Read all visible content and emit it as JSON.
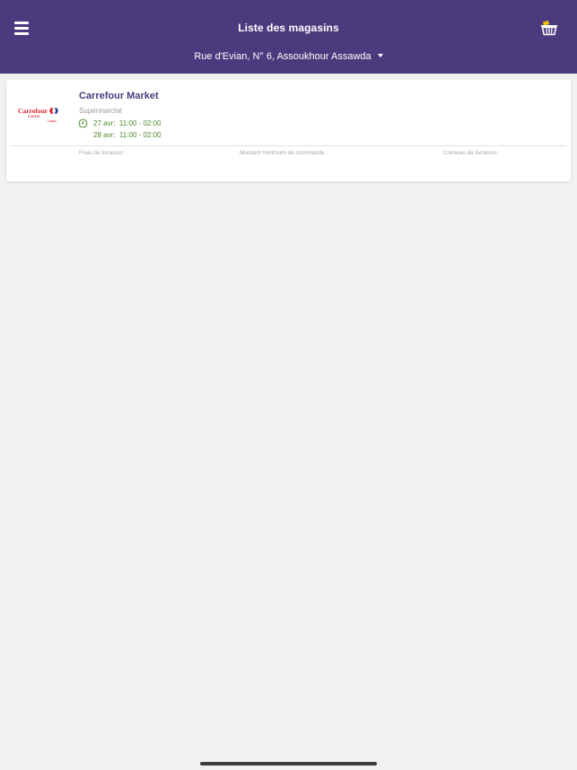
{
  "header": {
    "title": "Liste des magasins",
    "address": "Rue d'Evian, N° 6, Assoukhour Assawda",
    "menu_icon": "hamburger-menu-icon",
    "cart_icon": "shopping-basket-icon",
    "background": "#4b3b7e"
  },
  "stores": [
    {
      "name": "Carrefour Market",
      "type": "Supermarché",
      "logo": {
        "line1": "Carrefour",
        "line2": "market",
        "line3": "Lagos"
      },
      "slots": [
        {
          "date": "27 avr:",
          "time": "11:00 - 02:00"
        },
        {
          "date": "28 avr:",
          "time": "11:00 - 02:00"
        }
      ],
      "labels": {
        "delivery_fee": "Frais de livraison :",
        "min_order": "Montant minimum de commande :",
        "delivery_slot": "Créneau de livraison:"
      }
    }
  ],
  "colors": {
    "accent": "#4b3b7e",
    "slot_text": "#4e8a2e",
    "brand_red": "#d81e2b",
    "brand_blue": "#1b3a8e"
  }
}
